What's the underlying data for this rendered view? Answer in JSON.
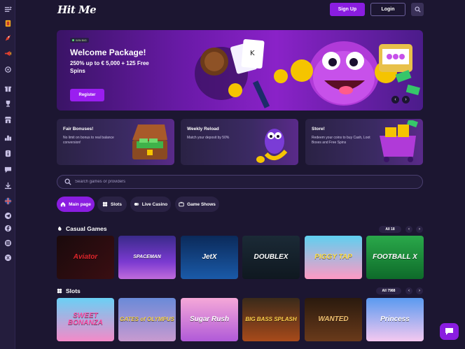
{
  "header": {
    "logo": "Hit Me",
    "signup_label": "Sign Up",
    "login_label": "Login"
  },
  "hero": {
    "badge": "WIN BIG",
    "title": "Welcome Package!",
    "subtitle": "250% up to € 5,000 + 125 Free Spins",
    "cta_label": "Register"
  },
  "promos": [
    {
      "title": "Fair Bonuses!",
      "desc": "No limit on bonus to real balance conversion!"
    },
    {
      "title": "Weekly Reload",
      "desc": "Match your deposit by 50%"
    },
    {
      "title": "Store!",
      "desc": "Redeem your coins to buy Cash, Loot Boxes and Free Spins"
    }
  ],
  "search": {
    "placeholder": "Search games or providers"
  },
  "tabs": [
    {
      "label": "Main page",
      "icon": "house-icon"
    },
    {
      "label": "Slots",
      "icon": "slots-icon"
    },
    {
      "label": "Live Casino",
      "icon": "live-casino-icon"
    },
    {
      "label": "Game Shows",
      "icon": "tv-icon"
    }
  ],
  "casual": {
    "title": "Casual Games",
    "all_label": "All 18",
    "games": [
      {
        "name": "Aviator"
      },
      {
        "name": "SPACEMAN"
      },
      {
        "name": "JetX"
      },
      {
        "name": "DOUBLEX"
      },
      {
        "name": "PIGGY TAP"
      },
      {
        "name": "FOOTBALL X"
      }
    ]
  },
  "slots": {
    "title": "Slots",
    "all_label": "All 7988",
    "games": [
      {
        "name": "SWEET BONANZA"
      },
      {
        "name": "GATES of OLYMPUS"
      },
      {
        "name": "Sugar Rush"
      },
      {
        "name": "BIG BASS SPLASH"
      },
      {
        "name": "WANTED"
      },
      {
        "name": "Princess"
      }
    ]
  },
  "colors": {
    "accent": "#8a1de0",
    "background": "#1c1631",
    "sidebar": "#241d3d"
  }
}
